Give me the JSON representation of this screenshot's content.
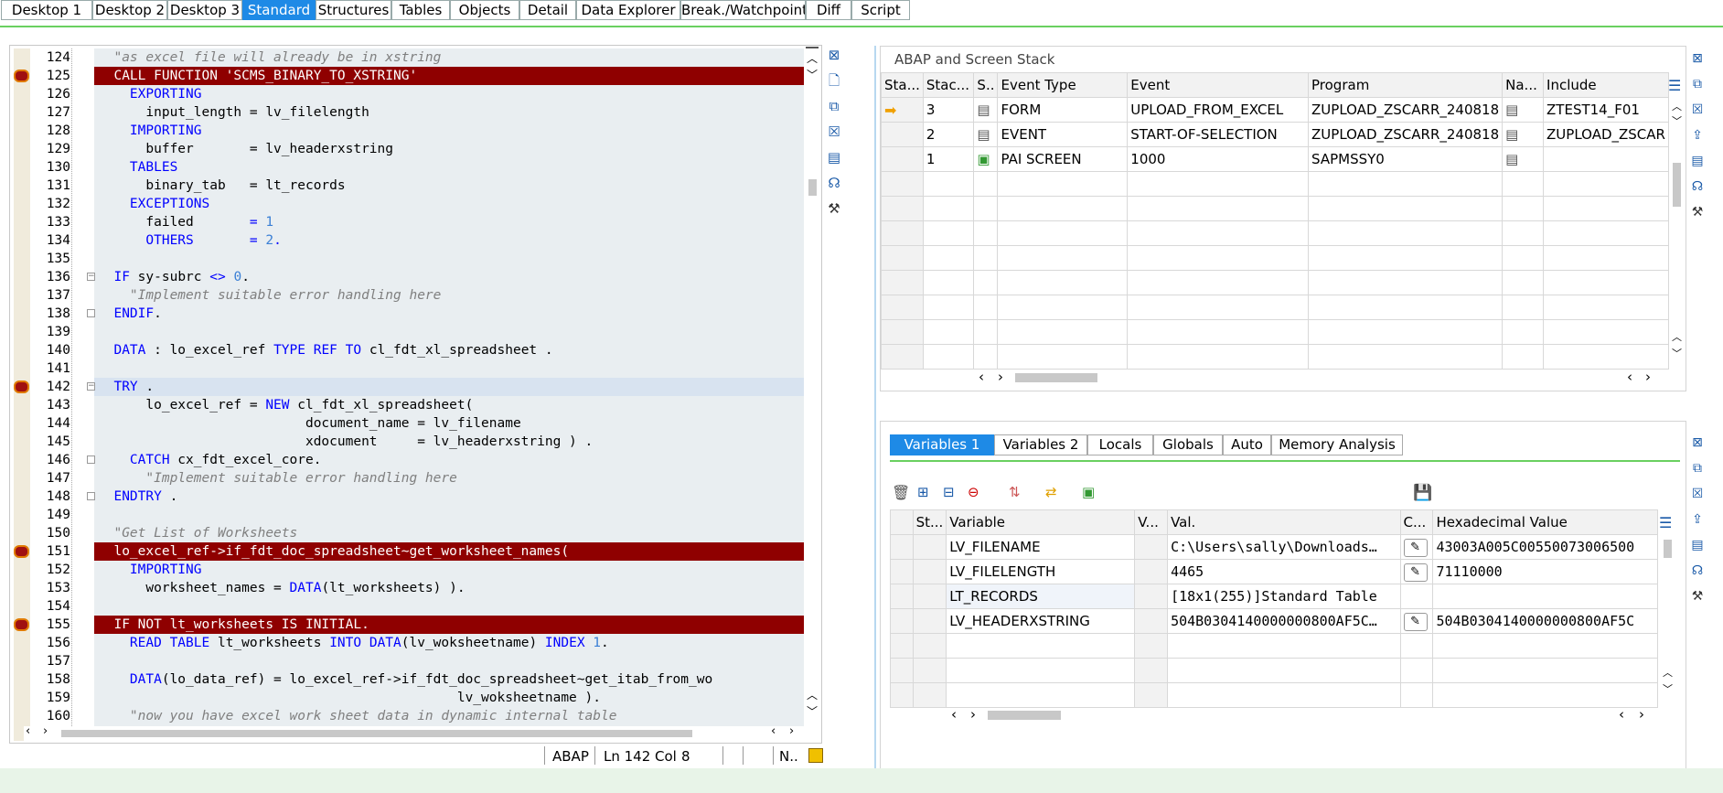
{
  "tabs": [
    "Desktop 1",
    "Desktop 2",
    "Desktop 3",
    "Standard",
    "Structures",
    "Tables",
    "Objects",
    "Detail",
    "Data Explorer",
    "Break./Watchpoints",
    "Diff",
    "Script"
  ],
  "active_tab": "Standard",
  "editor": {
    "lines": [
      {
        "n": "124",
        "html": "<span class='cm'>  \"as excel file will already be in xstring</span>"
      },
      {
        "n": "125",
        "bp": true,
        "html": "  CALL FUNCTION 'SCMS_BINARY_TO_XSTRING'"
      },
      {
        "n": "126",
        "html": "    <span class='kw'>EXPORTING</span>"
      },
      {
        "n": "127",
        "html": "      input_length = lv_filelength"
      },
      {
        "n": "128",
        "html": "    <span class='kw'>IMPORTING</span>"
      },
      {
        "n": "129",
        "html": "      buffer       = lv_headerxstring"
      },
      {
        "n": "130",
        "html": "    <span class='kw'>TABLES</span>"
      },
      {
        "n": "131",
        "html": "      binary_tab   = lt_records"
      },
      {
        "n": "132",
        "html": "    <span class='kw'>EXCEPTIONS</span>"
      },
      {
        "n": "133",
        "html": "      failed       <span class='kw'>=</span> <span class='nm'>1</span>"
      },
      {
        "n": "134",
        "html": "      <span class='kw'>OTHERS</span>       <span class='kw'>=</span> <span class='nm'>2</span><span class='kw'>.</span>"
      },
      {
        "n": "135",
        "html": ""
      },
      {
        "n": "136",
        "html": "  <span class='kw'>IF</span> sy-subrc <span class='kw'>&lt;&gt;</span> <span class='nm'>0</span>."
      },
      {
        "n": "137",
        "html": "<span class='cm'>    \"Implement suitable error handling here</span>"
      },
      {
        "n": "138",
        "html": "  <span class='kw'>ENDIF</span>."
      },
      {
        "n": "139",
        "html": ""
      },
      {
        "n": "140",
        "html": "  <span class='kw'>DATA</span> : lo_excel_ref <span class='kw'>TYPE REF TO</span> cl_fdt_xl_spreadsheet ."
      },
      {
        "n": "141",
        "html": ""
      },
      {
        "n": "142",
        "hl": true,
        "html": "  <span class='kw'>TRY</span> ."
      },
      {
        "n": "143",
        "html": "      lo_excel_ref = <span class='kw'>NEW</span> cl_fdt_xl_spreadsheet("
      },
      {
        "n": "144",
        "html": "                          document_name = lv_filename"
      },
      {
        "n": "145",
        "html": "                          xdocument     = lv_headerxstring ) ."
      },
      {
        "n": "146",
        "html": "    <span class='kw'>CATCH</span> cx_fdt_excel_core."
      },
      {
        "n": "147",
        "html": "<span class='cm'>      \"Implement suitable error handling here</span>"
      },
      {
        "n": "148",
        "html": "  <span class='kw'>ENDTRY</span> ."
      },
      {
        "n": "149",
        "html": ""
      },
      {
        "n": "150",
        "html": "<span class='cm'>  \"Get List of Worksheets</span>"
      },
      {
        "n": "151",
        "bp": true,
        "html": "  lo_excel_ref->if_fdt_doc_spreadsheet~get_worksheet_names("
      },
      {
        "n": "152",
        "html": "    <span class='kw'>IMPORTING</span>"
      },
      {
        "n": "153",
        "html": "      worksheet_names = <span class='kw'>DATA</span>(lt_worksheets) )."
      },
      {
        "n": "154",
        "html": ""
      },
      {
        "n": "155",
        "bp": true,
        "html": "  IF NOT lt_worksheets IS INITIAL."
      },
      {
        "n": "156",
        "html": "    <span class='kw'>READ TABLE</span> lt_worksheets <span class='kw'>INTO DATA</span>(lv_woksheetname) <span class='kw'>INDEX</span> <span class='nm'>1</span>."
      },
      {
        "n": "157",
        "html": ""
      },
      {
        "n": "158",
        "html": "    <span class='kw'>DATA</span>(lo_data_ref) = lo_excel_ref->if_fdt_doc_spreadsheet~get_itab_from_wo"
      },
      {
        "n": "159",
        "html": "                                             lv_woksheetname )."
      },
      {
        "n": "160",
        "html": "<span class='cm'>    \"now you have excel work sheet data in dynamic internal table</span>"
      }
    ]
  },
  "status": {
    "lang": "ABAP",
    "position": "Ln 142 Col",
    "col": "8",
    "extra": "N.."
  },
  "stack": {
    "title": "ABAP and Screen Stack",
    "columns": [
      "Sta...",
      "Stac...",
      "S..",
      "Event Type",
      "Event",
      "Program",
      "Na...",
      "Include"
    ],
    "rows": [
      {
        "level": "3",
        "type": "FORM",
        "event": "UPLOAD_FROM_EXCEL",
        "program": "ZUPLOAD_ZSCARR_240818",
        "include": "ZTEST14_F01",
        "current": true
      },
      {
        "level": "2",
        "type": "EVENT",
        "event": "START-OF-SELECTION",
        "program": "ZUPLOAD_ZSCARR_240818",
        "include": "ZUPLOAD_ZSCAR"
      },
      {
        "level": "1",
        "type": "PAI SCREEN",
        "event": "1000",
        "program": "SAPMSSY0",
        "include": ""
      }
    ]
  },
  "variables": {
    "tabs": [
      "Variables 1",
      "Variables 2",
      "Locals",
      "Globals",
      "Auto",
      "Memory Analysis"
    ],
    "active_tab": "Variables 1",
    "columns": [
      "St...",
      "Variable",
      "V...",
      "Val.",
      "C...",
      "Hexadecimal Value"
    ],
    "rows": [
      {
        "name": "LV_FILENAME",
        "value": "C:\\Users\\sally\\Downloads…",
        "hex": "43003A005C00550073006500",
        "editable": true
      },
      {
        "name": "LV_FILELENGTH",
        "value": "4465",
        "hex": "71110000",
        "editable": true
      },
      {
        "name": "LT_RECORDS",
        "value": "[18x1(255)]Standard Table",
        "hex": "",
        "editable": false
      },
      {
        "name": "LV_HEADERXSTRING",
        "value": "504B0304140000000800AF5C…",
        "hex": "504B0304140000000800AF5C",
        "editable": true
      }
    ]
  }
}
